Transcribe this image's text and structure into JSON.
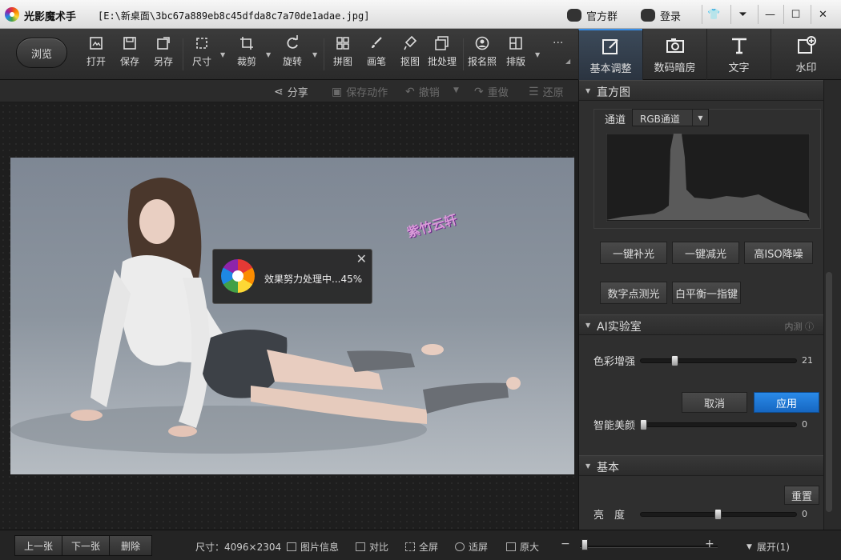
{
  "titlebar": {
    "app_title": "光影魔术手",
    "file_title": "[E:\\新桌面\\3bc67a889eb8c45dfda8c7a70de1adae.jpg]",
    "group_label": "官方群",
    "login_label": "登录"
  },
  "toolbar": {
    "browse_label": "浏览",
    "items": [
      {
        "label": "打开",
        "icon": "open-icon"
      },
      {
        "label": "保存",
        "icon": "save-icon"
      },
      {
        "label": "另存",
        "icon": "save-as-icon"
      },
      {
        "label": "尺寸",
        "icon": "resize-icon"
      },
      {
        "label": "裁剪",
        "icon": "crop-icon"
      },
      {
        "label": "旋转",
        "icon": "rotate-icon"
      },
      {
        "label": "拼图",
        "icon": "collage-icon"
      },
      {
        "label": "画笔",
        "icon": "brush-icon"
      },
      {
        "label": "抠图",
        "icon": "cutout-icon"
      },
      {
        "label": "批处理",
        "icon": "batch-icon"
      },
      {
        "label": "报名照",
        "icon": "id-photo-icon"
      },
      {
        "label": "排版",
        "icon": "layout-icon"
      }
    ],
    "more_label": "···"
  },
  "right_tabs": [
    {
      "label": "基本调整",
      "icon": "adjust-icon",
      "active": true
    },
    {
      "label": "数码暗房",
      "icon": "darkroom-icon"
    },
    {
      "label": "文字",
      "icon": "text-icon"
    },
    {
      "label": "水印",
      "icon": "watermark-icon"
    }
  ],
  "action_bar": {
    "share": "分享",
    "save_action": "保存动作",
    "undo": "撤销",
    "redo": "重做",
    "restore": "还原"
  },
  "image": {
    "watermark_text": "紫竹云轩"
  },
  "processing": {
    "message": "效果努力处理中...45%",
    "progress_percent": 45
  },
  "histogram": {
    "section_title": "直方图",
    "channel_label": "通道",
    "channel_value": "RGB通道"
  },
  "quick_buttons": [
    "一键补光",
    "一键减光",
    "高ISO降噪",
    "数字点测光",
    "白平衡一指键"
  ],
  "ai_lab": {
    "section_title": "AI实验室",
    "tag": "内测",
    "color_enhance_label": "色彩增强",
    "color_enhance_value": "21",
    "cancel_label": "取消",
    "apply_label": "应用",
    "beauty_label": "智能美颜",
    "beauty_value": "0"
  },
  "basic": {
    "section_title": "基本",
    "reset_label": "重置",
    "brightness_label": "亮　度",
    "brightness_value": "0"
  },
  "bottom": {
    "prev_label": "上一张",
    "next_label": "下一张",
    "delete_label": "删除",
    "size_text": "尺寸：4096×2304",
    "info_label": "图片信息",
    "compare_label": "对比",
    "fullscreen_label": "全屏",
    "fit_label": "适屏",
    "original_label": "原大",
    "zoom_minus": "−",
    "zoom_plus": "+",
    "expand_label": "展开(1)"
  },
  "colors": {
    "accent": "#1e7fd8",
    "panel_bg": "#2f2f2f",
    "toolbar_bg": "#333333"
  }
}
